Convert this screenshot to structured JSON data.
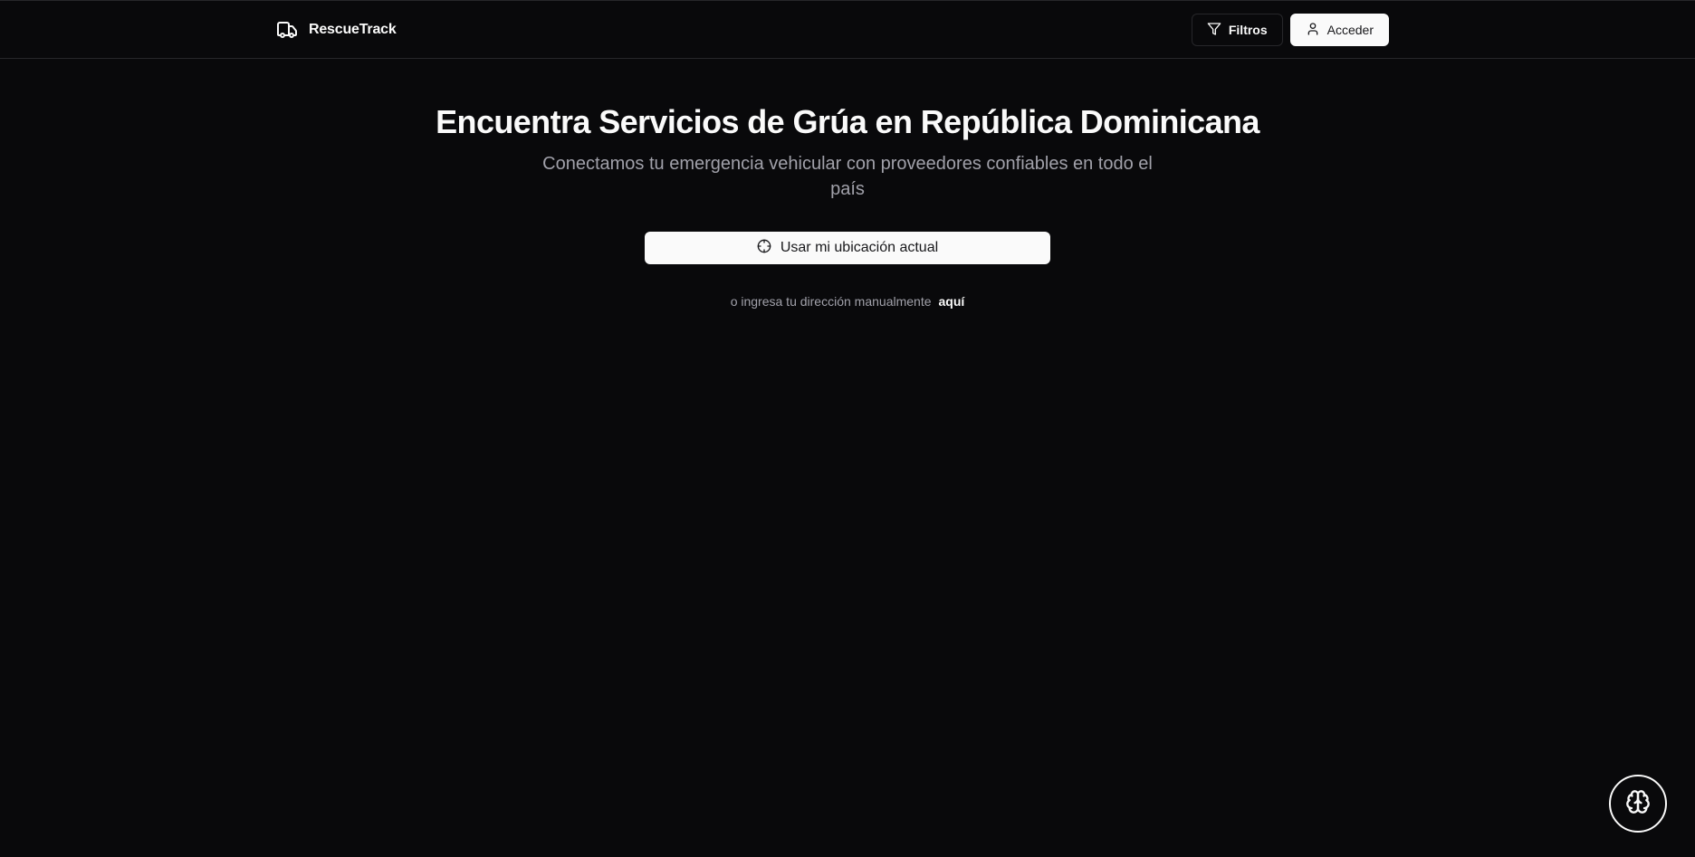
{
  "header": {
    "brand_name": "RescueTrack",
    "brand_icon": "truck-icon",
    "filters_label": "Filtros",
    "filters_icon": "filter-icon",
    "login_label": "Acceder",
    "login_icon": "user-icon"
  },
  "hero": {
    "title": "Encuentra Servicios de Grúa en República Dominicana",
    "subtitle": "Conectamos tu emergencia vehicular con proveedores confiables en todo el país",
    "locate_button_label": "Usar mi ubicación actual",
    "locate_icon": "crosshair-icon",
    "manual_prefix": "o ingresa tu dirección manualmente",
    "manual_link": "aquí"
  },
  "fab": {
    "icon": "brain-icon"
  },
  "colors": {
    "background": "#09090b",
    "foreground": "#fafafa",
    "muted": "#a1a1aa",
    "border": "#27272a"
  }
}
